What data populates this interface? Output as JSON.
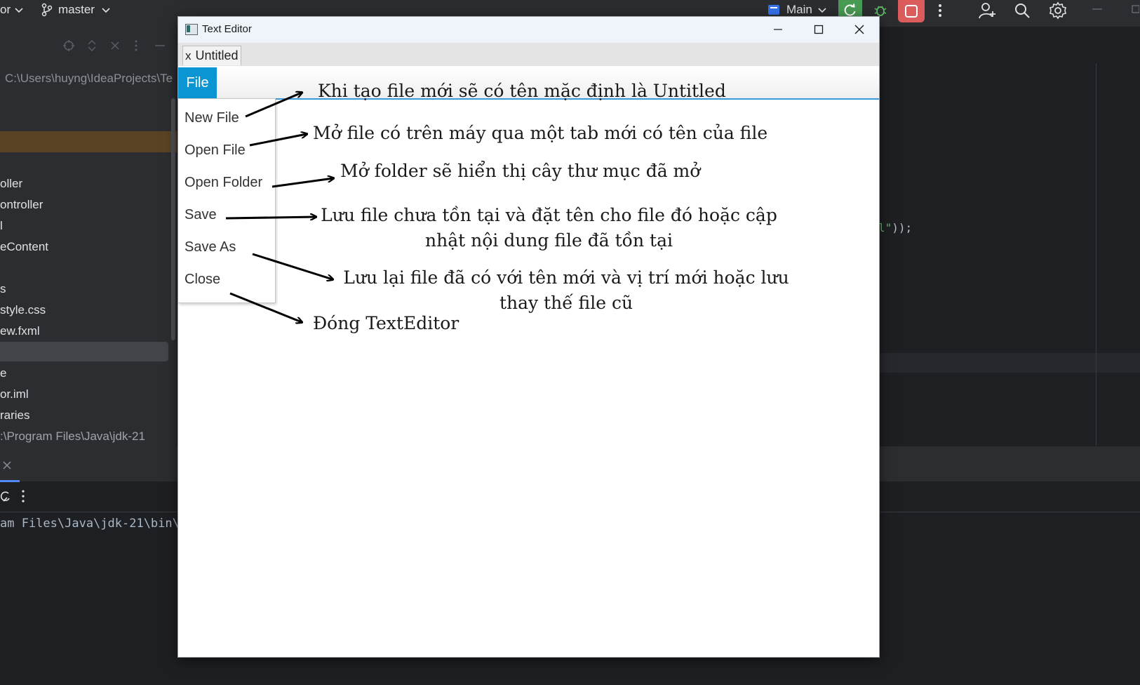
{
  "ide": {
    "project_partial": "or",
    "branch": "master",
    "run_config": "Main",
    "project_path": "C:\\Users\\huyng\\IdeaProjects\\Te",
    "tree_items": [
      "oller",
      "ontroller",
      "l",
      "eContent",
      "s",
      "style.css",
      "ew.fxml",
      "e",
      "or.iml",
      "raries"
    ],
    "jdk_path": ":\\Program Files\\Java\\jdk-21",
    "code_fragment_string": "l\"",
    "code_fragment_rest": "));",
    "console_line": "am Files\\Java\\jdk-21\\bin\\j"
  },
  "window": {
    "title": "Text Editor",
    "tab_close": "x",
    "tab_label": "Untitled",
    "menu_file": "File"
  },
  "menu": {
    "items": [
      "New File",
      "Open File",
      "Open Folder",
      "Save",
      "Save As",
      "Close"
    ]
  },
  "annotations": {
    "new_file": "Khi tạo file mới sẽ có tên mặc định là Untitled",
    "open_file": "Mở file có trên máy qua một tab mới có tên của file",
    "open_folder": "Mở folder sẽ hiển thị cây thư mục đã mở",
    "save_line1": "Lưu file chưa tồn tại và đặt tên cho file đó hoặc cập",
    "save_line2": "nhật nội dung file đã tồn tại",
    "save_as_line1": "Lưu lại file đã có với tên mới và vị trí mới hoặc lưu",
    "save_as_line2": "thay thế file cũ",
    "close": "Đóng TextEditor"
  },
  "colors": {
    "menu_accent": "#0b96d3",
    "ide_background": "#1e1f22",
    "run_button": "#499c54",
    "stop_button": "#db5c5c"
  },
  "icons": [
    "chevron-down-icon",
    "branch-icon",
    "run-config-icon",
    "rerun-icon",
    "debug-icon",
    "stop-icon",
    "more-icon",
    "add-user-icon",
    "search-icon",
    "settings-icon",
    "minimize-icon",
    "maximize-icon",
    "close-icon",
    "app-icon"
  ]
}
